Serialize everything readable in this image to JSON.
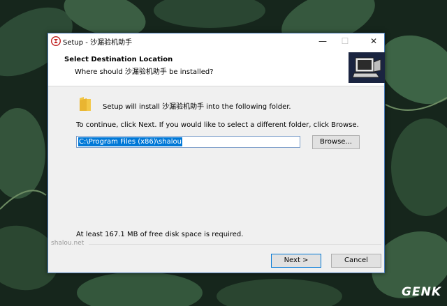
{
  "window": {
    "title": "Setup - 沙漏验机助手",
    "minimize_glyph": "—",
    "maximize_glyph": "☐",
    "close_glyph": "✕"
  },
  "header": {
    "title": "Select Destination Location",
    "subtitle": "Where should 沙漏验机助手 be installed?"
  },
  "body": {
    "install_text": "Setup will install 沙漏验机助手 into the following folder.",
    "continue_text": "To continue, click Next. If you would like to select a different folder, click Browse.",
    "path_value": "C:\\Program Files (x86)\\shalou",
    "browse_label": "Browse...",
    "space_text": "At least 167.1 MB of free disk space is required."
  },
  "footer": {
    "brand": "shalou.net",
    "next_label": "Next >",
    "cancel_label": "Cancel"
  },
  "watermark": "GENK",
  "icons": [
    "app-icon",
    "installer-computer-icon",
    "folder-icon"
  ],
  "colors": {
    "accent": "#0078d7",
    "window_bg": "#f0f0f0",
    "header_bg": "#ffffff"
  }
}
